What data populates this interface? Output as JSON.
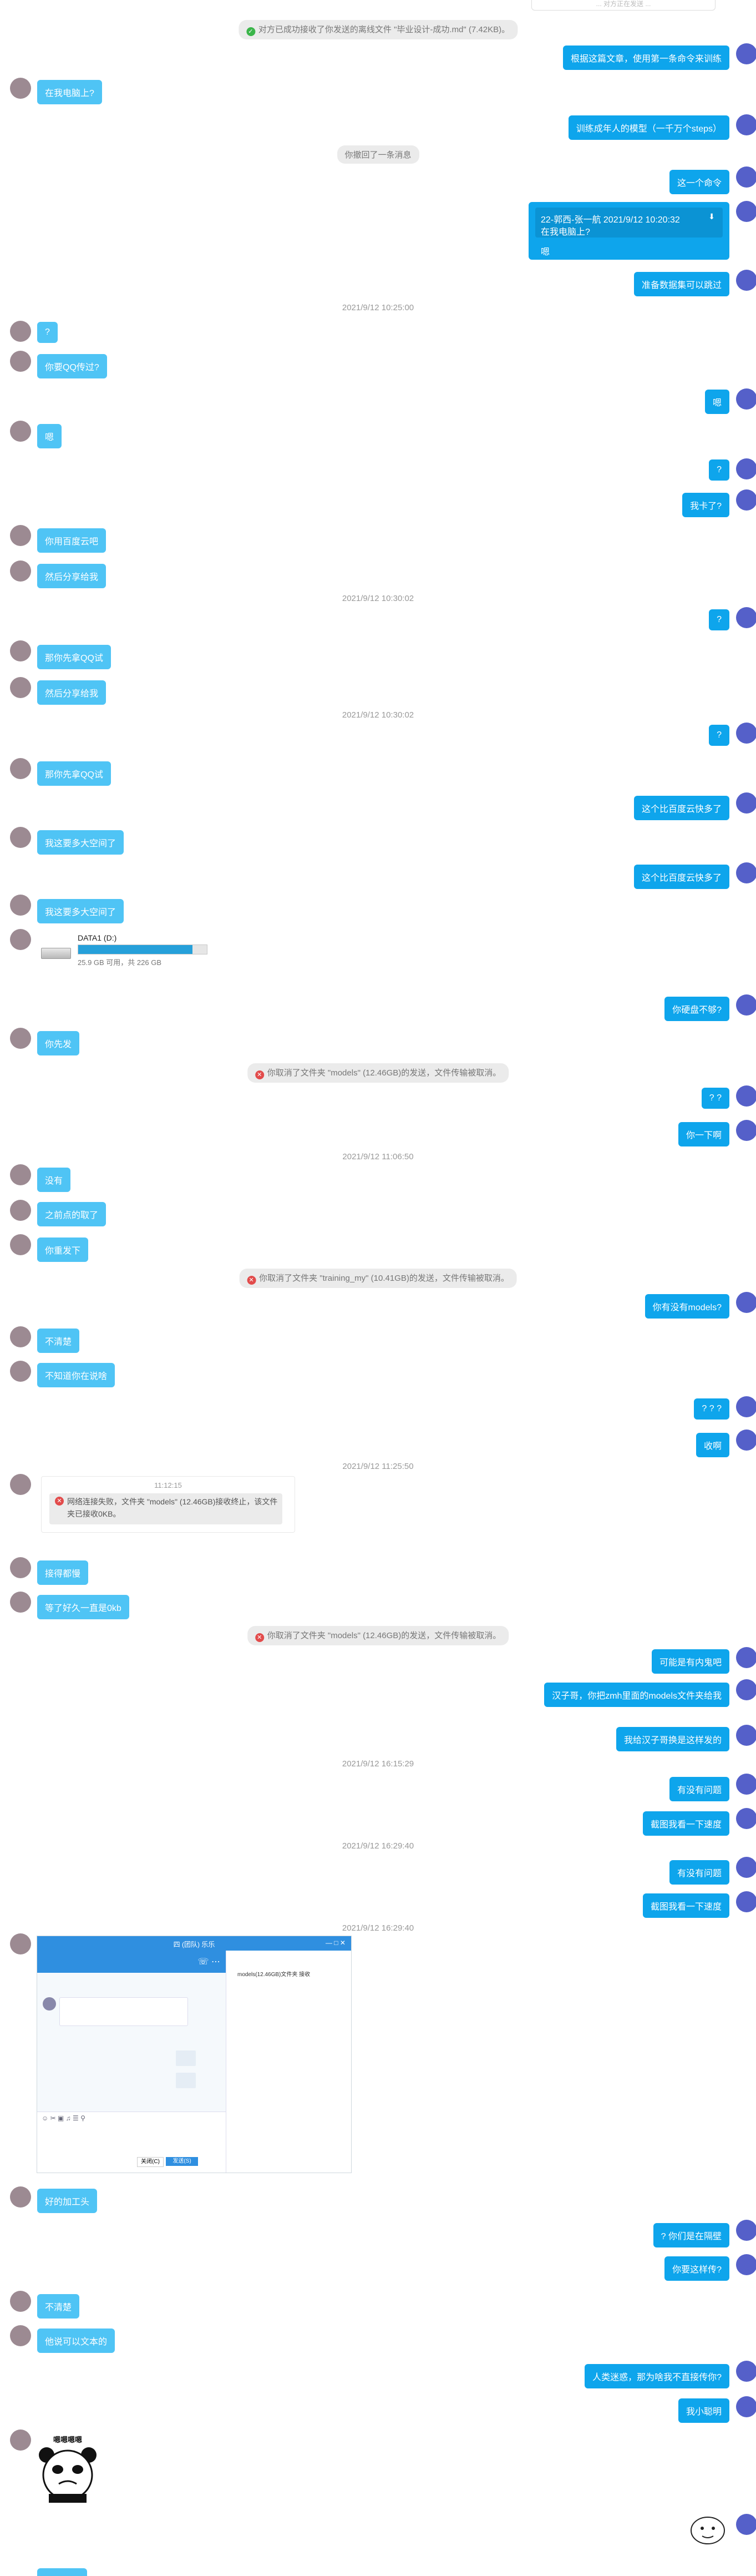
{
  "top_fragment": "... 对方正在发送 ...",
  "system_messages": {
    "s1": "对方已成功接收了你发送的离线文件 \"毕业设计-成功.md\" (7.42KB)。",
    "s2": "你撤回了一条消息",
    "s3": "你取消了文件夹 \"models\" (12.46GB)的发送，文件传输被取消。",
    "s4": "你取消了文件夹 \"training_my\" (10.41GB)的发送，文件传输被取消。",
    "s5": "你取消了文件夹 \"models\" (12.46GB)的发送，文件传输被取消。"
  },
  "timestamps": {
    "t1": "2021/9/12 10:25:00",
    "t2": "2021/9/12 10:30:02",
    "t3": "2021/9/12 10:30:02",
    "t4": "2021/9/12 11:06:50",
    "t5": "2021/9/12 11:25:50",
    "t6": "2021/9/12 16:15:29",
    "t7": "2021/9/12 16:29:40",
    "t8": "2021/9/12 16:29:40"
  },
  "messages": {
    "r1": "根据这篇文章，使用第一条命令来训练",
    "l1": "在我电脑上?",
    "r2": "训练成年人的模型（一千万个steps）",
    "r3": "这一个命令",
    "quote": {
      "header": "22-郭西-张一航 2021/9/12 10:20:32",
      "quoted": "在我电脑上?",
      "reply": "嗯"
    },
    "r4": "准备数据集可以跳过",
    "l2": "?",
    "l3": "你要QQ传过?",
    "r5": "嗯",
    "l4": "嗯",
    "r6": "?",
    "r7": "我卡了?",
    "l5": "你用百度云吧",
    "l6": "然后分享给我",
    "r8": "?",
    "l7": "那你先拿QQ试",
    "l8": "然后分享给我",
    "r9": "?",
    "l9": "那你先拿QQ试",
    "r10": "这个比百度云快多了",
    "l10": "我这要多大空间了",
    "r11": "这个比百度云快多了",
    "l11": "我这要多大空间了",
    "r12": "你硬盘不够?",
    "l12": "你先发",
    "r13": "? ?",
    "r14": "你一下啊",
    "l13": "没有",
    "l14": "之前点的取了",
    "l15": "你重发下",
    "r15": "你有没有models?",
    "l16": "不清楚",
    "l17": "不知道你在说啥",
    "r16": "? ? ?",
    "r17": "收啊",
    "l18": "接得都慢",
    "l19": "等了好久一直是0kb",
    "r18": "可能是有内鬼吧",
    "r19": "汉子哥，你把zmh里面的models文件夹给我",
    "r20": "我给汉子哥换是这样发的",
    "r21": "有没有问题",
    "r22": "截图我看一下速度",
    "r23": "有没有问题",
    "r24": "截图我看一下速度",
    "l20": "好的加工头",
    "r25": "? 你们是在隔壁",
    "r26": "你要这样传?",
    "l21": "不清楚",
    "l22": "他说可以文本的",
    "r27": "人类迷惑，那为啥我不直接传你?",
    "r28": "我小聪明"
  },
  "drive_card": {
    "name": "DATA1 (D:)",
    "usage": "25.9 GB 可用，共 226 GB",
    "used_fraction": 0.89
  },
  "notice_card": {
    "time": "11:12:15",
    "text": "网络连接失败，文件夹 \"models\" (12.46GB)接收终止，该文件夹已接收0KB。"
  },
  "screenshot_card": {
    "title": "四  (团队) 乐乐",
    "file_label": "models(12.46GB)文件夹 接收",
    "btn1": "关闭(C)",
    "btn2": "发送(S)"
  },
  "sticker": {
    "caption": "嗯嗯嗯嗯"
  },
  "colors": {
    "right_bubble": "#0ea5ec",
    "left_bubble": "#4fc4f5",
    "success": "#3bb54a",
    "error": "#e24b4b"
  }
}
